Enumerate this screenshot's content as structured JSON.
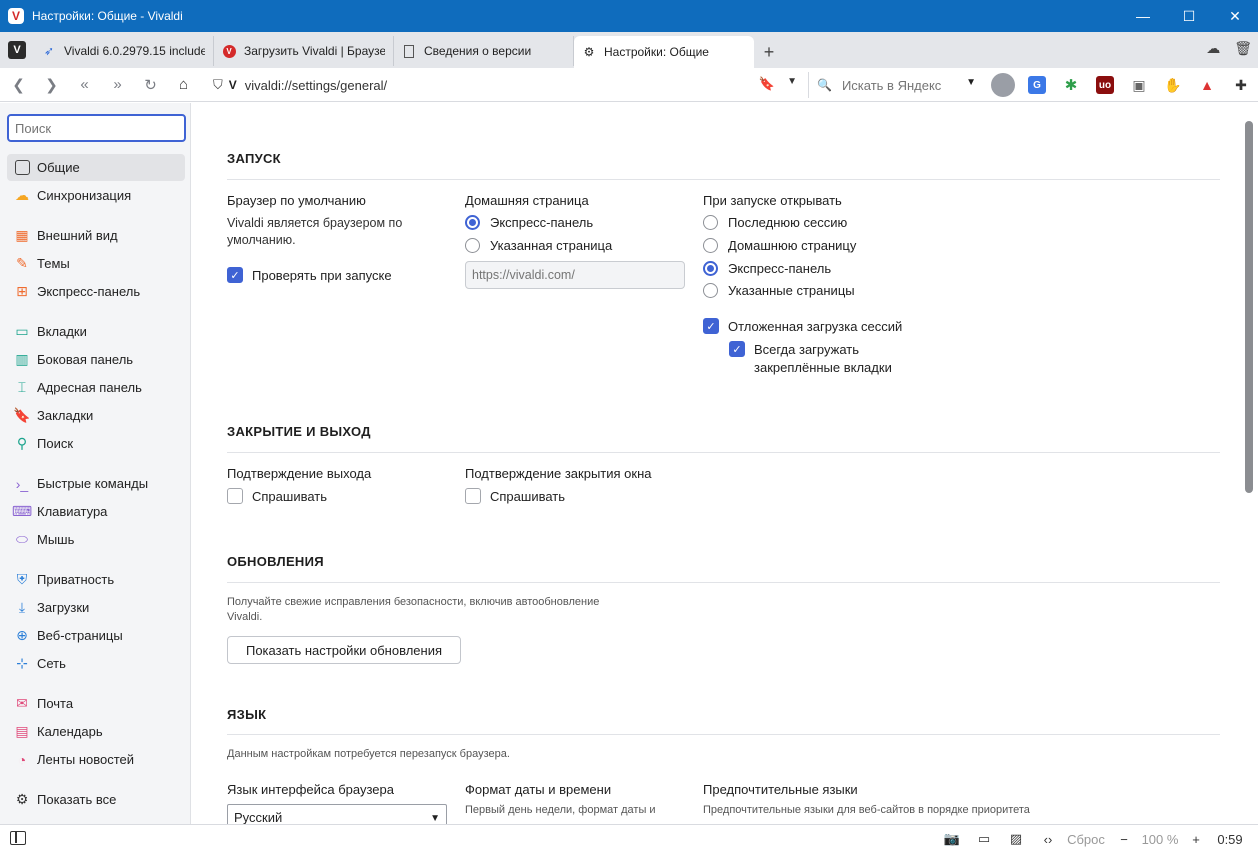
{
  "window": {
    "title": "Настройки: Общие - Vivaldi",
    "logo": "V",
    "minimize": "—",
    "maximize": "☐",
    "close": "✕"
  },
  "tabs": [
    {
      "label": "Vivaldi 6.0.2979.15 include",
      "icon": "vivaldi-bird-icon"
    },
    {
      "label": "Загрузить Vivaldi | Браузер",
      "icon": "vivaldi-logo-icon"
    },
    {
      "label": "Сведения о версии",
      "icon": "document-icon"
    },
    {
      "label": "Настройки: Общие",
      "icon": "gear-icon",
      "active": true
    }
  ],
  "tabstrip": {
    "menu_logo": "V",
    "new_tab": "+"
  },
  "address": {
    "url": "vivaldi://settings/general/",
    "search_placeholder": "Искать в Яндекс"
  },
  "sidebar": {
    "search_placeholder": "Поиск",
    "items": [
      {
        "label": "Общие",
        "icon": "general-icon",
        "active": true
      },
      {
        "label": "Синхронизация",
        "icon": "cloud-icon"
      },
      {
        "label": "Внешний вид",
        "icon": "appearance-icon"
      },
      {
        "label": "Темы",
        "icon": "brush-icon"
      },
      {
        "label": "Экспресс-панель",
        "icon": "speed-dial-icon"
      },
      {
        "label": "Вкладки",
        "icon": "tabs-icon"
      },
      {
        "label": "Боковая панель",
        "icon": "side-panel-icon"
      },
      {
        "label": "Адресная панель",
        "icon": "address-bar-icon"
      },
      {
        "label": "Закладки",
        "icon": "bookmark-icon"
      },
      {
        "label": "Поиск",
        "icon": "search-icon"
      },
      {
        "label": "Быстрые команды",
        "icon": "quick-commands-icon"
      },
      {
        "label": "Клавиатура",
        "icon": "keyboard-icon"
      },
      {
        "label": "Мышь",
        "icon": "mouse-icon"
      },
      {
        "label": "Приватность",
        "icon": "privacy-shield-icon"
      },
      {
        "label": "Загрузки",
        "icon": "download-icon"
      },
      {
        "label": "Веб-страницы",
        "icon": "globe-icon"
      },
      {
        "label": "Сеть",
        "icon": "network-icon"
      },
      {
        "label": "Почта",
        "icon": "mail-icon"
      },
      {
        "label": "Календарь",
        "icon": "calendar-icon"
      },
      {
        "label": "Ленты новостей",
        "icon": "feed-icon"
      },
      {
        "label": "Показать все",
        "icon": "gear-icon"
      }
    ]
  },
  "startup": {
    "title": "ЗАПУСК",
    "default_browser": {
      "label": "Браузер по умолчанию",
      "desc_line1": "Vivaldi является браузером по",
      "desc_line2": "умолчанию.",
      "check_label": "Проверять при запуске",
      "checked": true
    },
    "homepage": {
      "label": "Домашняя страница",
      "options": [
        "Экспресс-панель",
        "Указанная страница"
      ],
      "selected": 0,
      "url_placeholder": "https://vivaldi.com/"
    },
    "on_startup": {
      "label": "При запуске открывать",
      "options": [
        "Последнюю сессию",
        "Домашнюю страницу",
        "Экспресс-панель",
        "Указанные страницы"
      ],
      "selected": 2,
      "lazy_load_label": "Отложенная загрузка сессий",
      "lazy_load_checked": true,
      "always_load_line1": "Всегда загружать",
      "always_load_line2": "закреплённые вкладки",
      "always_load_checked": true
    }
  },
  "exit": {
    "title": "ЗАКРЫТИЕ И ВЫХОД",
    "confirm_exit": {
      "label": "Подтверждение выхода",
      "check_label": "Спрашивать",
      "checked": false
    },
    "confirm_close": {
      "label": "Подтверждение закрытия окна",
      "check_label": "Спрашивать",
      "checked": false
    }
  },
  "updates": {
    "title": "ОБНОВЛЕНИЯ",
    "desc_line1": "Получайте свежие исправления безопасности, включив автообновление",
    "desc_line2": "Vivaldi.",
    "button": "Показать настройки обновления"
  },
  "language": {
    "title": "ЯЗЫК",
    "note": "Данным настройкам потребуется перезапуск браузера.",
    "ui_language": {
      "label": "Язык интерфейса браузера",
      "value": "Русский"
    },
    "date_format": {
      "label": "Формат даты и времени",
      "desc": "Первый день недели, формат даты и"
    },
    "preferred": {
      "label": "Предпочтительные языки",
      "desc": "Предпочтительные языки для веб-сайтов в порядке приоритета"
    }
  },
  "statusbar": {
    "reset": "Сброс",
    "zoom": "100 %",
    "minus": "−",
    "plus": "+",
    "time": "0:59"
  },
  "colors": {
    "accent": "#3f63d4",
    "titlebar": "#0f6cbd",
    "vivaldi_red": "#d42a2a"
  }
}
